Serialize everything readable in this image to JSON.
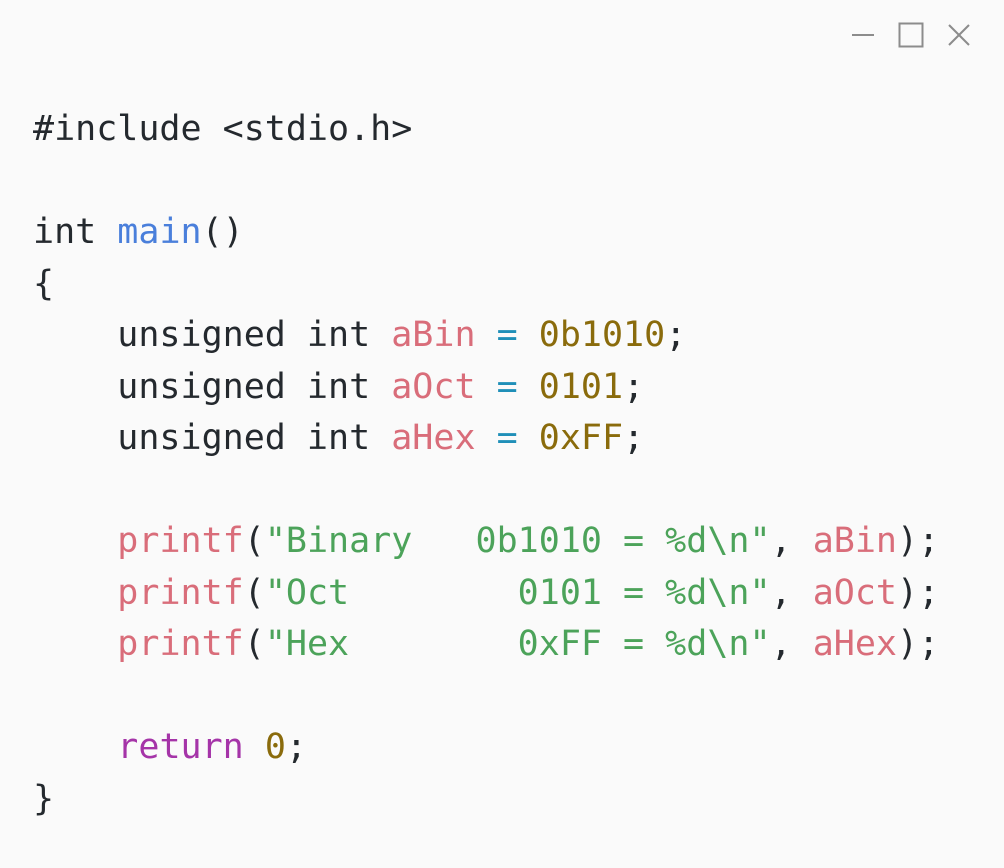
{
  "window": {
    "controls": {
      "minimize_icon": "minimize-icon",
      "maximize_icon": "maximize-icon",
      "close_icon": "close-icon"
    }
  },
  "colors": {
    "background": "#fafafa",
    "plain": "#24292e",
    "function": "#4a7fdb",
    "variable": "#d96d7a",
    "operator": "#1f8fb8",
    "number": "#8a6b0c",
    "string": "#4ca35a",
    "return_keyword": "#a534a8"
  },
  "code": {
    "lines": [
      {
        "tokens": [
          {
            "t": "#include <stdio.h>",
            "k": "plain"
          }
        ]
      },
      {
        "tokens": []
      },
      {
        "tokens": [
          {
            "t": "int ",
            "k": "keyword"
          },
          {
            "t": "main",
            "k": "func"
          },
          {
            "t": "()",
            "k": "plain"
          }
        ]
      },
      {
        "tokens": [
          {
            "t": "{",
            "k": "plain"
          }
        ]
      },
      {
        "tokens": [
          {
            "t": "    unsigned int ",
            "k": "keyword"
          },
          {
            "t": "aBin",
            "k": "var"
          },
          {
            "t": " ",
            "k": "plain"
          },
          {
            "t": "=",
            "k": "op"
          },
          {
            "t": " ",
            "k": "plain"
          },
          {
            "t": "0b1010",
            "k": "num"
          },
          {
            "t": ";",
            "k": "plain"
          }
        ]
      },
      {
        "tokens": [
          {
            "t": "    unsigned int ",
            "k": "keyword"
          },
          {
            "t": "aOct",
            "k": "var"
          },
          {
            "t": " ",
            "k": "plain"
          },
          {
            "t": "=",
            "k": "op"
          },
          {
            "t": " ",
            "k": "plain"
          },
          {
            "t": "0101",
            "k": "num"
          },
          {
            "t": ";",
            "k": "plain"
          }
        ]
      },
      {
        "tokens": [
          {
            "t": "    unsigned int ",
            "k": "keyword"
          },
          {
            "t": "aHex",
            "k": "var"
          },
          {
            "t": " ",
            "k": "plain"
          },
          {
            "t": "=",
            "k": "op"
          },
          {
            "t": " ",
            "k": "plain"
          },
          {
            "t": "0xFF",
            "k": "num"
          },
          {
            "t": ";",
            "k": "plain"
          }
        ]
      },
      {
        "tokens": []
      },
      {
        "tokens": [
          {
            "t": "    ",
            "k": "plain"
          },
          {
            "t": "printf",
            "k": "call"
          },
          {
            "t": "(",
            "k": "plain"
          },
          {
            "t": "\"Binary   0b1010 = %d\\n\"",
            "k": "str"
          },
          {
            "t": ", ",
            "k": "plain"
          },
          {
            "t": "aBin",
            "k": "var"
          },
          {
            "t": ");",
            "k": "plain"
          }
        ]
      },
      {
        "tokens": [
          {
            "t": "    ",
            "k": "plain"
          },
          {
            "t": "printf",
            "k": "call"
          },
          {
            "t": "(",
            "k": "plain"
          },
          {
            "t": "\"Oct        0101 = %d\\n\"",
            "k": "str"
          },
          {
            "t": ", ",
            "k": "plain"
          },
          {
            "t": "aOct",
            "k": "var"
          },
          {
            "t": ");",
            "k": "plain"
          }
        ]
      },
      {
        "tokens": [
          {
            "t": "    ",
            "k": "plain"
          },
          {
            "t": "printf",
            "k": "call"
          },
          {
            "t": "(",
            "k": "plain"
          },
          {
            "t": "\"Hex        0xFF = %d\\n\"",
            "k": "str"
          },
          {
            "t": ", ",
            "k": "plain"
          },
          {
            "t": "aHex",
            "k": "var"
          },
          {
            "t": ");",
            "k": "plain"
          }
        ]
      },
      {
        "tokens": []
      },
      {
        "tokens": [
          {
            "t": "    ",
            "k": "plain"
          },
          {
            "t": "return",
            "k": "return"
          },
          {
            "t": " ",
            "k": "plain"
          },
          {
            "t": "0",
            "k": "num"
          },
          {
            "t": ";",
            "k": "plain"
          }
        ]
      },
      {
        "tokens": [
          {
            "t": "}",
            "k": "plain"
          }
        ]
      }
    ]
  }
}
